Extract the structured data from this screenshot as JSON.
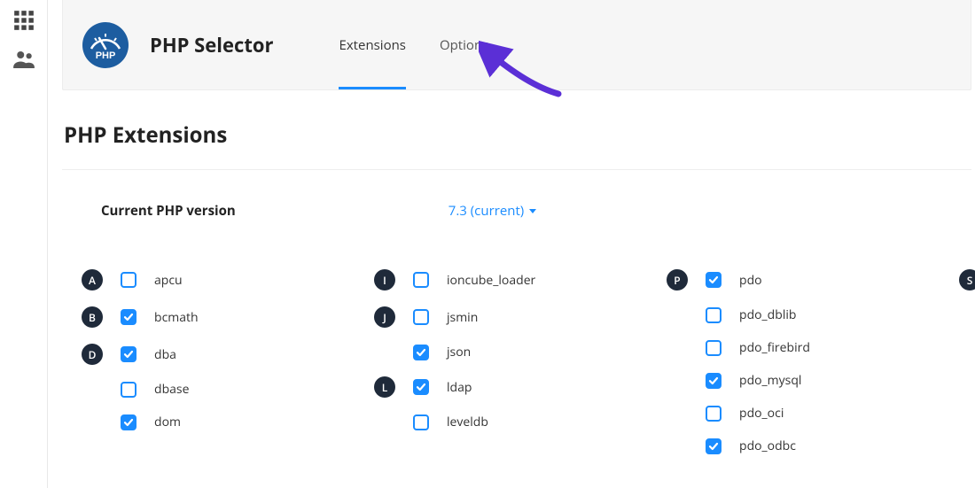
{
  "header": {
    "app_title": "PHP Selector",
    "tabs": {
      "extensions": "Extensions",
      "options": "Options"
    }
  },
  "section_title": "PHP Extensions",
  "version": {
    "label": "Current PHP version",
    "value": "7.3 (current)"
  },
  "columns": [
    {
      "groups": [
        {
          "letter": "A",
          "items": [
            {
              "name": "apcu",
              "checked": false
            }
          ]
        },
        {
          "letter": "B",
          "items": [
            {
              "name": "bcmath",
              "checked": true
            }
          ]
        },
        {
          "letter": "D",
          "items": [
            {
              "name": "dba",
              "checked": true
            },
            {
              "name": "dbase",
              "checked": false
            },
            {
              "name": "dom",
              "checked": true
            }
          ]
        }
      ]
    },
    {
      "groups": [
        {
          "letter": "I",
          "items": [
            {
              "name": "ioncube_loader",
              "checked": false
            }
          ]
        },
        {
          "letter": "J",
          "items": [
            {
              "name": "jsmin",
              "checked": false
            },
            {
              "name": "json",
              "checked": true
            }
          ]
        },
        {
          "letter": "L",
          "items": [
            {
              "name": "ldap",
              "checked": true
            },
            {
              "name": "leveldb",
              "checked": false
            }
          ]
        }
      ]
    },
    {
      "groups": [
        {
          "letter": "P",
          "items": [
            {
              "name": "pdo",
              "checked": true
            },
            {
              "name": "pdo_dblib",
              "checked": false
            },
            {
              "name": "pdo_firebird",
              "checked": false
            },
            {
              "name": "pdo_mysql",
              "checked": true
            },
            {
              "name": "pdo_oci",
              "checked": false
            },
            {
              "name": "pdo_odbc",
              "checked": true
            }
          ]
        }
      ]
    },
    {
      "groups": [
        {
          "letter": "S",
          "items": []
        }
      ]
    }
  ]
}
